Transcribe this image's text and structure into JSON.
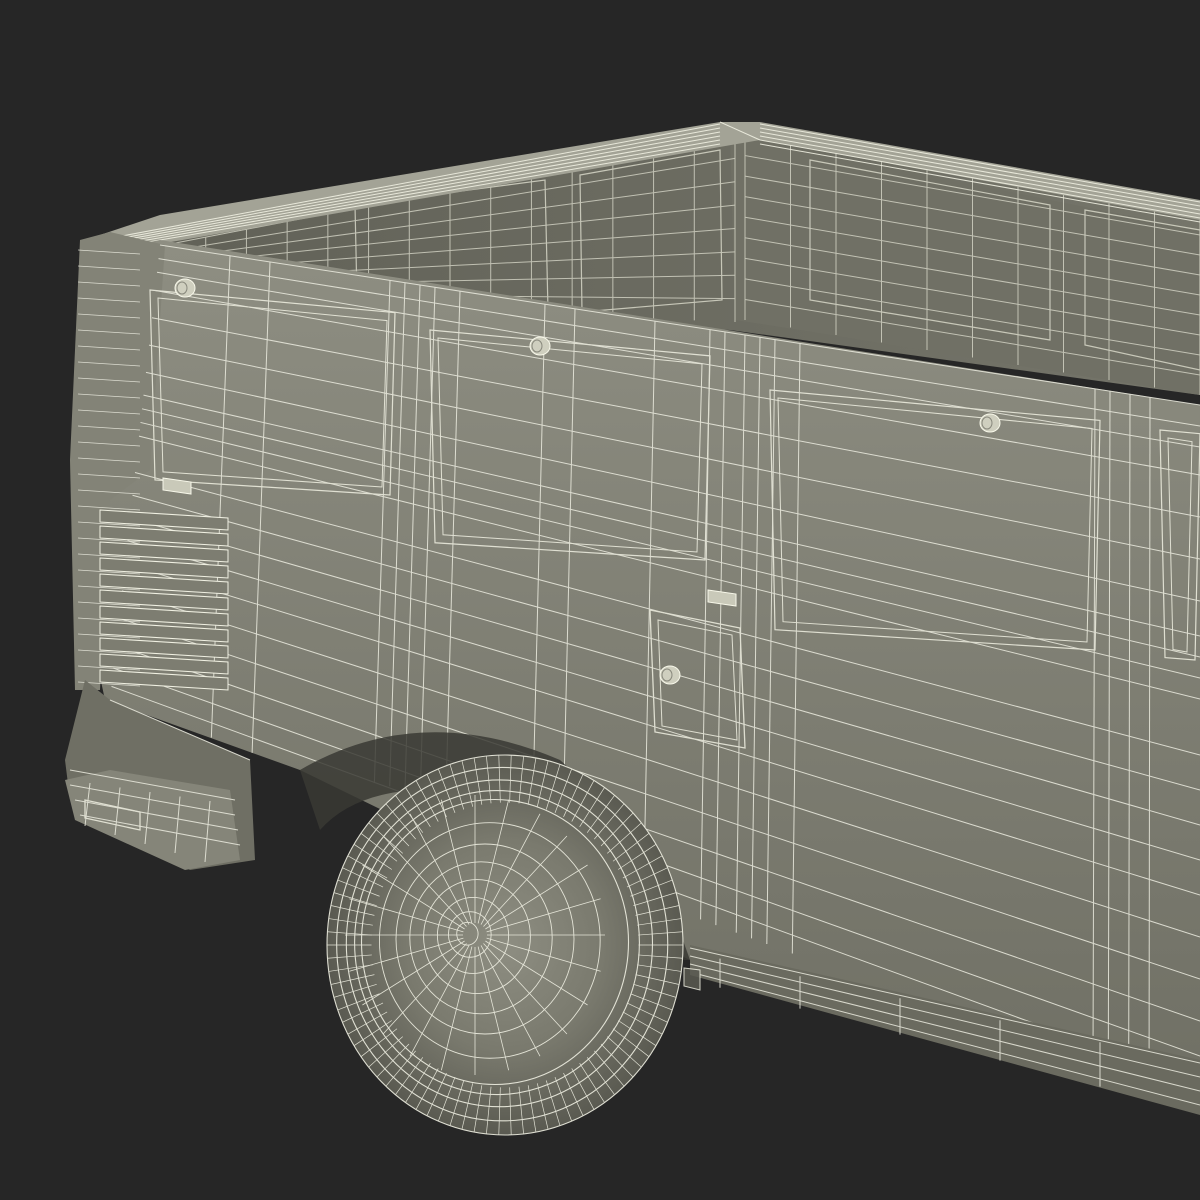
{
  "colors": {
    "background": "#262626",
    "body_light": "#8d8d80",
    "body_mid": "#7a7a6e",
    "body_dark": "#5e5e54",
    "inner_wall": "#6c6c61",
    "wire": "#e8e8da",
    "tire": "#7c7c70",
    "tire_dark": "#4e4e46"
  },
  "scene": {
    "subject": "pickup-truck-rear-wireframe",
    "render_style": "wireframe-over-clay"
  }
}
